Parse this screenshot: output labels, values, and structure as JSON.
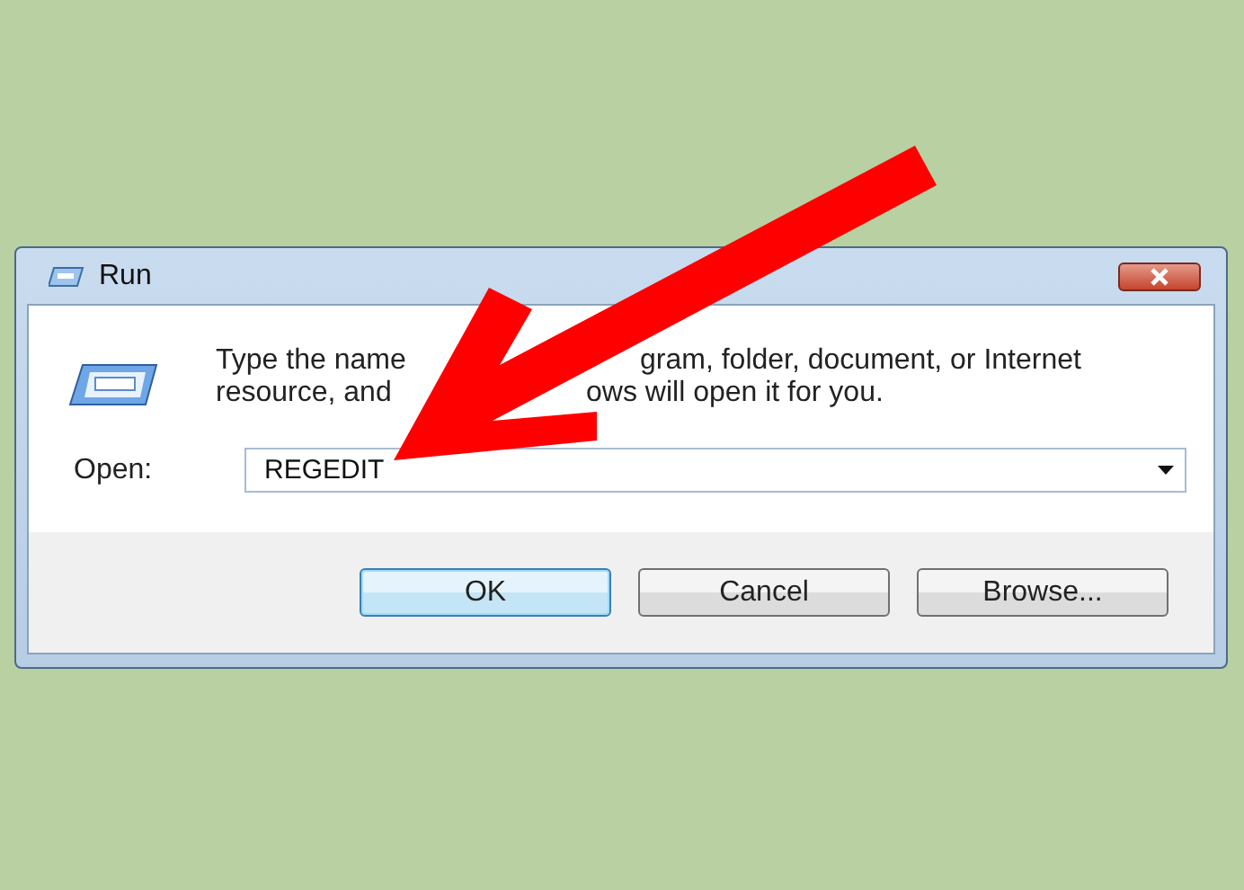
{
  "window": {
    "title": "Run"
  },
  "description": {
    "lines": [
      [
        "Type the name",
        "gram, folder, document, or Internet"
      ],
      [
        "resource, and",
        "ows will open it for you."
      ]
    ]
  },
  "open_field": {
    "label": "Open:",
    "value": "REGEDIT"
  },
  "buttons": [
    {
      "label": "OK",
      "default": true
    },
    {
      "label": "Cancel",
      "default": false
    },
    {
      "label": "Browse...",
      "default": false
    }
  ]
}
